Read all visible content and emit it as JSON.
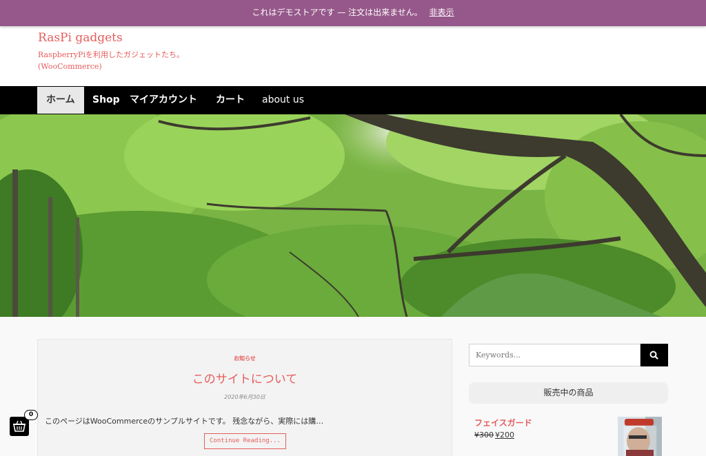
{
  "demo_banner": {
    "text": "これはデモストアです — 注文は出来ません。",
    "dismiss_label": "非表示"
  },
  "header": {
    "site_title": "RasPi gadgets",
    "site_description_line1": "RaspberryPiを利用したガジェットたち。",
    "site_description_line2": "(WooCommerce)"
  },
  "nav": {
    "items": [
      {
        "label": "ホーム",
        "active": true
      },
      {
        "label": "Shop"
      },
      {
        "label": "マイアカウント"
      },
      {
        "label": "カート"
      },
      {
        "label": "about us"
      }
    ]
  },
  "post": {
    "category": "お知らせ",
    "title": "このサイトについて",
    "date": "2020年6月30日",
    "excerpt": "このページはWooCommerceのサンプルサイトです。 残念ながら、実際には購…",
    "continue_label": "Continue Reading..."
  },
  "sidebar": {
    "search_placeholder": "Keywords...",
    "products_title": "販売中の商品",
    "product": {
      "name": "フェイスガード",
      "price_old": "¥300",
      "price_new": "¥200"
    }
  },
  "cart": {
    "count": "0"
  },
  "colors": {
    "banner": "#96588a",
    "accent": "#e65c5c",
    "nav_bg": "#000000"
  }
}
